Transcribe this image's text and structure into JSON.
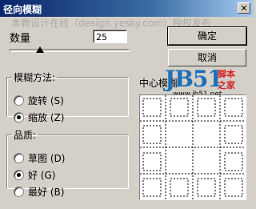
{
  "window": {
    "title": "径向模糊",
    "close_glyph": "✕"
  },
  "watermark": "本教设计在线（design.yesky.com）授权发布",
  "amount": {
    "label": "数量",
    "value": "25",
    "slider_fraction": 0.25
  },
  "buttons": {
    "ok": "确定",
    "cancel": "取消"
  },
  "method": {
    "legend": "模糊方法:",
    "options": [
      {
        "label": "旋转 (S)",
        "selected": false
      },
      {
        "label": "缩放 (Z)",
        "selected": true
      }
    ]
  },
  "quality": {
    "legend": "品质:",
    "options": [
      {
        "label": "草图 (D)",
        "selected": false
      },
      {
        "label": "好 (G)",
        "selected": true
      },
      {
        "label": "最好 (B)",
        "selected": false
      }
    ]
  },
  "center": {
    "label": "中心模糊"
  },
  "logo": {
    "brand": "JB51",
    "sub1": "脚本",
    "sub2": "之家",
    "url": "www.jb51.net"
  }
}
